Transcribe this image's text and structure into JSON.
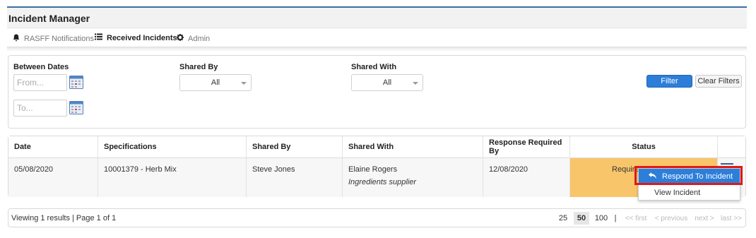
{
  "app": {
    "title": "Incident Manager"
  },
  "tabs": [
    {
      "label": "RASFF Notifications",
      "icon": "bell-icon",
      "active": false
    },
    {
      "label": "Received Incidents",
      "icon": "list-icon",
      "active": true
    },
    {
      "label": "Admin",
      "icon": "gear-icon",
      "active": false
    }
  ],
  "filters": {
    "between_dates_label": "Between Dates",
    "from_placeholder": "From...",
    "to_placeholder": "To...",
    "shared_by_label": "Shared By",
    "shared_by_value": "All",
    "shared_with_label": "Shared With",
    "shared_with_value": "All",
    "filter_button": "Filter",
    "clear_button": "Clear Filters"
  },
  "table": {
    "headers": [
      "Date",
      "Specifications",
      "Shared By",
      "Shared With",
      "Response Required By",
      "Status"
    ],
    "rows": [
      {
        "date": "05/08/2020",
        "specifications": "10001379 - Herb Mix",
        "shared_by": "Steve Jones",
        "shared_with": "Elaine Rogers",
        "shared_with_org": "Ingredients supplier",
        "response_required_by": "12/08/2020",
        "status": "Requires Attention"
      }
    ]
  },
  "context_menu": {
    "items": [
      "Respond To Incident",
      "View Incident"
    ],
    "selected_index": 0
  },
  "pagination": {
    "info": "Viewing 1 results | Page 1 of 1",
    "page_sizes": [
      "25",
      "50",
      "100"
    ],
    "current_size": "50",
    "separator": "|",
    "first": "<< first",
    "previous": "< previous",
    "next": "next >",
    "last": "last >>"
  },
  "colors": {
    "accent": "#2d7ed9",
    "status_warning": "#f9c56a",
    "highlight": "#e01818"
  }
}
